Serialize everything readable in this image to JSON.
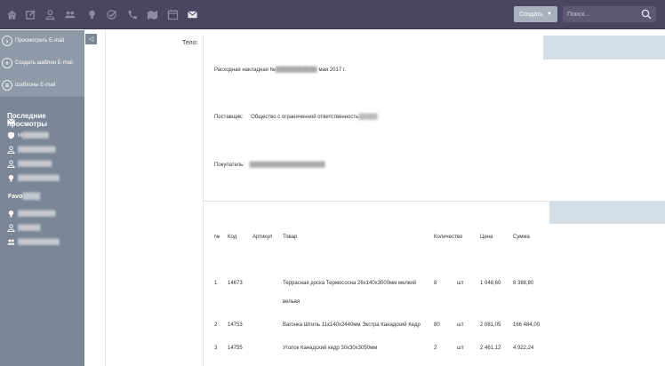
{
  "topbar": {
    "icons": [
      "home-icon",
      "edit-icon",
      "user-icon",
      "users-icon",
      "bulb-icon",
      "check-icon",
      "phone-icon",
      "map-icon",
      "calendar-icon",
      "mail-icon"
    ],
    "create_label": "Создать",
    "search_placeholder": "Поиск..."
  },
  "sidebar": {
    "actions": [
      {
        "label": "Просмотреть E-mail",
        "icon": "arrow-right-icon"
      },
      {
        "label": "Создать шаблон E-mail",
        "icon": "plus-icon"
      },
      {
        "label": "Шаблоны E-mail",
        "icon": "list-icon"
      }
    ],
    "recent_heading": "Последние просмотры",
    "recent_items": [
      {
        "icon": "mail-icon",
        "label": ""
      },
      {
        "icon": "shield-icon",
        "label": "M"
      },
      {
        "icon": "user-icon",
        "label": ""
      },
      {
        "icon": "user-icon",
        "label": ""
      },
      {
        "icon": "bulb-icon",
        "label": ""
      }
    ],
    "favorites_heading": "Favo",
    "favorite_items": [
      {
        "icon": "bulb-icon",
        "label": ""
      },
      {
        "icon": "user-icon",
        "label": ""
      },
      {
        "icon": "users-icon",
        "label": ""
      }
    ]
  },
  "editor": {
    "body_label": "Тело:",
    "invoice_prefix": "Расходная накладная №",
    "invoice_suffix": "мая 2017 г.",
    "supplier_label": "Поставщик:",
    "supplier_value": "Общество с ограниченной ответственность",
    "buyer_label": "Покупатель:"
  },
  "table": {
    "headers": [
      "№",
      "Код",
      "Артикул",
      "Товар",
      "Количество",
      "Цена",
      "Сумма"
    ],
    "rows": [
      {
        "num": "1",
        "code": "14673",
        "article": "",
        "product": "Террасная доска Термососна 26х140х3000мм мелкий",
        "product_line2": "вельвя",
        "qty": "8",
        "unit": "шт",
        "price": "1 048,60",
        "sum": "8 388,80"
      },
      {
        "num": "2",
        "code": "14753",
        "article": "",
        "product": "Вагонка Штиль 11х140х2440мм Экстра Канадский Кедр",
        "product_line2": "",
        "qty": "80",
        "unit": "шт",
        "price": "2 081,05",
        "sum": "166 484,00"
      },
      {
        "num": "3",
        "code": "14755",
        "article": "",
        "product": "Уголок Канадский кедр 30х30х3050мм",
        "product_line2": "",
        "qty": "2",
        "unit": "шт",
        "price": "2 461,12",
        "sum": "4 922,24"
      }
    ]
  }
}
